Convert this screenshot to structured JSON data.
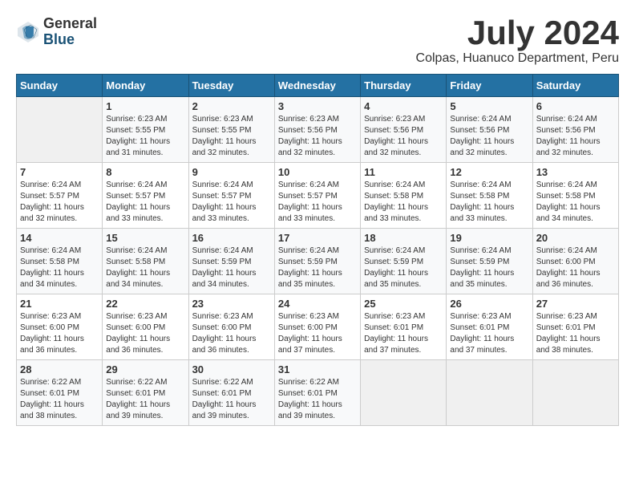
{
  "logo": {
    "general": "General",
    "blue": "Blue"
  },
  "title": "July 2024",
  "location": "Colpas, Huanuco Department, Peru",
  "days_of_week": [
    "Sunday",
    "Monday",
    "Tuesday",
    "Wednesday",
    "Thursday",
    "Friday",
    "Saturday"
  ],
  "weeks": [
    [
      {
        "day": "",
        "sunrise": "",
        "sunset": "",
        "daylight": "",
        "empty": true
      },
      {
        "day": "1",
        "sunrise": "Sunrise: 6:23 AM",
        "sunset": "Sunset: 5:55 PM",
        "daylight": "Daylight: 11 hours and 31 minutes."
      },
      {
        "day": "2",
        "sunrise": "Sunrise: 6:23 AM",
        "sunset": "Sunset: 5:55 PM",
        "daylight": "Daylight: 11 hours and 32 minutes."
      },
      {
        "day": "3",
        "sunrise": "Sunrise: 6:23 AM",
        "sunset": "Sunset: 5:56 PM",
        "daylight": "Daylight: 11 hours and 32 minutes."
      },
      {
        "day": "4",
        "sunrise": "Sunrise: 6:23 AM",
        "sunset": "Sunset: 5:56 PM",
        "daylight": "Daylight: 11 hours and 32 minutes."
      },
      {
        "day": "5",
        "sunrise": "Sunrise: 6:24 AM",
        "sunset": "Sunset: 5:56 PM",
        "daylight": "Daylight: 11 hours and 32 minutes."
      },
      {
        "day": "6",
        "sunrise": "Sunrise: 6:24 AM",
        "sunset": "Sunset: 5:56 PM",
        "daylight": "Daylight: 11 hours and 32 minutes."
      }
    ],
    [
      {
        "day": "7",
        "sunrise": "Sunrise: 6:24 AM",
        "sunset": "Sunset: 5:57 PM",
        "daylight": "Daylight: 11 hours and 32 minutes."
      },
      {
        "day": "8",
        "sunrise": "Sunrise: 6:24 AM",
        "sunset": "Sunset: 5:57 PM",
        "daylight": "Daylight: 11 hours and 33 minutes."
      },
      {
        "day": "9",
        "sunrise": "Sunrise: 6:24 AM",
        "sunset": "Sunset: 5:57 PM",
        "daylight": "Daylight: 11 hours and 33 minutes."
      },
      {
        "day": "10",
        "sunrise": "Sunrise: 6:24 AM",
        "sunset": "Sunset: 5:57 PM",
        "daylight": "Daylight: 11 hours and 33 minutes."
      },
      {
        "day": "11",
        "sunrise": "Sunrise: 6:24 AM",
        "sunset": "Sunset: 5:58 PM",
        "daylight": "Daylight: 11 hours and 33 minutes."
      },
      {
        "day": "12",
        "sunrise": "Sunrise: 6:24 AM",
        "sunset": "Sunset: 5:58 PM",
        "daylight": "Daylight: 11 hours and 33 minutes."
      },
      {
        "day": "13",
        "sunrise": "Sunrise: 6:24 AM",
        "sunset": "Sunset: 5:58 PM",
        "daylight": "Daylight: 11 hours and 34 minutes."
      }
    ],
    [
      {
        "day": "14",
        "sunrise": "Sunrise: 6:24 AM",
        "sunset": "Sunset: 5:58 PM",
        "daylight": "Daylight: 11 hours and 34 minutes."
      },
      {
        "day": "15",
        "sunrise": "Sunrise: 6:24 AM",
        "sunset": "Sunset: 5:58 PM",
        "daylight": "Daylight: 11 hours and 34 minutes."
      },
      {
        "day": "16",
        "sunrise": "Sunrise: 6:24 AM",
        "sunset": "Sunset: 5:59 PM",
        "daylight": "Daylight: 11 hours and 34 minutes."
      },
      {
        "day": "17",
        "sunrise": "Sunrise: 6:24 AM",
        "sunset": "Sunset: 5:59 PM",
        "daylight": "Daylight: 11 hours and 35 minutes."
      },
      {
        "day": "18",
        "sunrise": "Sunrise: 6:24 AM",
        "sunset": "Sunset: 5:59 PM",
        "daylight": "Daylight: 11 hours and 35 minutes."
      },
      {
        "day": "19",
        "sunrise": "Sunrise: 6:24 AM",
        "sunset": "Sunset: 5:59 PM",
        "daylight": "Daylight: 11 hours and 35 minutes."
      },
      {
        "day": "20",
        "sunrise": "Sunrise: 6:24 AM",
        "sunset": "Sunset: 6:00 PM",
        "daylight": "Daylight: 11 hours and 36 minutes."
      }
    ],
    [
      {
        "day": "21",
        "sunrise": "Sunrise: 6:23 AM",
        "sunset": "Sunset: 6:00 PM",
        "daylight": "Daylight: 11 hours and 36 minutes."
      },
      {
        "day": "22",
        "sunrise": "Sunrise: 6:23 AM",
        "sunset": "Sunset: 6:00 PM",
        "daylight": "Daylight: 11 hours and 36 minutes."
      },
      {
        "day": "23",
        "sunrise": "Sunrise: 6:23 AM",
        "sunset": "Sunset: 6:00 PM",
        "daylight": "Daylight: 11 hours and 36 minutes."
      },
      {
        "day": "24",
        "sunrise": "Sunrise: 6:23 AM",
        "sunset": "Sunset: 6:00 PM",
        "daylight": "Daylight: 11 hours and 37 minutes."
      },
      {
        "day": "25",
        "sunrise": "Sunrise: 6:23 AM",
        "sunset": "Sunset: 6:01 PM",
        "daylight": "Daylight: 11 hours and 37 minutes."
      },
      {
        "day": "26",
        "sunrise": "Sunrise: 6:23 AM",
        "sunset": "Sunset: 6:01 PM",
        "daylight": "Daylight: 11 hours and 37 minutes."
      },
      {
        "day": "27",
        "sunrise": "Sunrise: 6:23 AM",
        "sunset": "Sunset: 6:01 PM",
        "daylight": "Daylight: 11 hours and 38 minutes."
      }
    ],
    [
      {
        "day": "28",
        "sunrise": "Sunrise: 6:22 AM",
        "sunset": "Sunset: 6:01 PM",
        "daylight": "Daylight: 11 hours and 38 minutes."
      },
      {
        "day": "29",
        "sunrise": "Sunrise: 6:22 AM",
        "sunset": "Sunset: 6:01 PM",
        "daylight": "Daylight: 11 hours and 39 minutes."
      },
      {
        "day": "30",
        "sunrise": "Sunrise: 6:22 AM",
        "sunset": "Sunset: 6:01 PM",
        "daylight": "Daylight: 11 hours and 39 minutes."
      },
      {
        "day": "31",
        "sunrise": "Sunrise: 6:22 AM",
        "sunset": "Sunset: 6:01 PM",
        "daylight": "Daylight: 11 hours and 39 minutes."
      },
      {
        "day": "",
        "sunrise": "",
        "sunset": "",
        "daylight": "",
        "empty": true
      },
      {
        "day": "",
        "sunrise": "",
        "sunset": "",
        "daylight": "",
        "empty": true
      },
      {
        "day": "",
        "sunrise": "",
        "sunset": "",
        "daylight": "",
        "empty": true
      }
    ]
  ]
}
